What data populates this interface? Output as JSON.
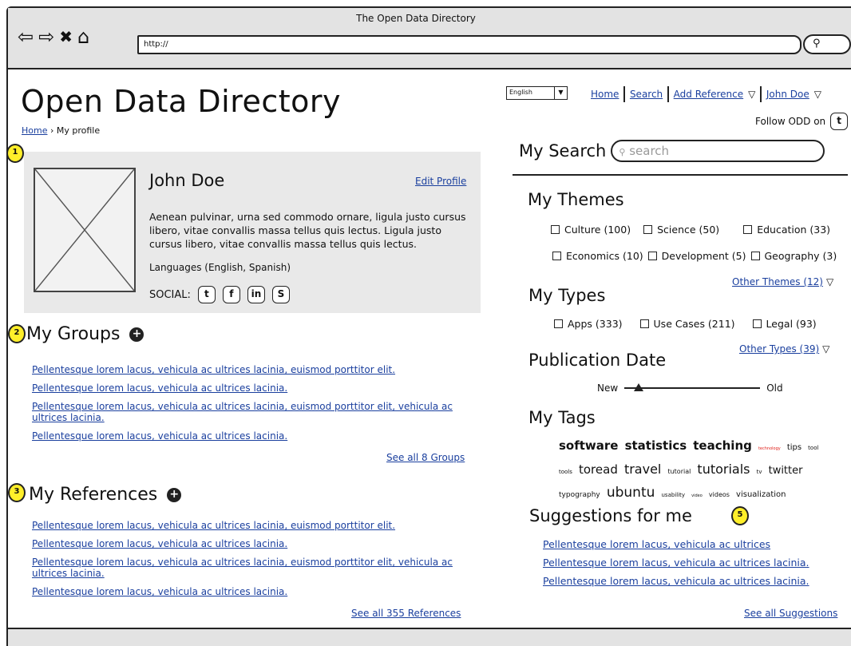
{
  "window": {
    "title": "The Open Data Directory",
    "url": "http://"
  },
  "page": {
    "title": "Open Data Directory",
    "breadcrumb": {
      "home": "Home",
      "separator": "›",
      "current": "My profile"
    }
  },
  "badges": [
    "1",
    "2",
    "3",
    "5"
  ],
  "profile": {
    "name": "John Doe",
    "edit_label": "Edit Profile",
    "bio": "Aenean pulvinar, urna sed commodo ornare, ligula justo cursus libero, vitae convallis massa tellus quis lectus. Ligula justo cursus libero, vitae convallis massa tellus quis lectus.",
    "languages": "Languages (English, Spanish)",
    "social_label": "SOCIAL:",
    "social_icons": [
      "twitter-icon",
      "facebook-icon",
      "linkedin-icon",
      "skype-icon"
    ]
  },
  "groups": {
    "heading": "My Groups",
    "items": [
      "Pellentesque lorem lacus, vehicula ac ultrices lacinia, euismod porttitor elit.",
      "Pellentesque lorem lacus, vehicula ac ultrices lacinia.",
      "Pellentesque lorem lacus, vehicula ac ultrices lacinia, euismod porttitor elit, vehicula ac ultrices lacinia.",
      "Pellentesque lorem lacus, vehicula ac ultrices lacinia."
    ],
    "see_all": "See all 8 Groups"
  },
  "references": {
    "heading": "My References",
    "items": [
      "Pellentesque lorem lacus, vehicula ac ultrices lacinia, euismod porttitor elit.",
      "Pellentesque lorem lacus, vehicula ac ultrices lacinia.",
      "Pellentesque lorem lacus, vehicula ac ultrices lacinia, euismod porttitor elit, vehicula ac ultrices lacinia.",
      "Pellentesque lorem lacus, vehicula ac ultrices lacinia."
    ],
    "see_all": "See all 355 References"
  },
  "header": {
    "language": "English",
    "nav": {
      "home": "Home",
      "search": "Search",
      "add_reference": "Add Reference",
      "user": "John Doe"
    },
    "follow": "Follow ODD on"
  },
  "search": {
    "heading": "My Search",
    "placeholder": "search"
  },
  "themes": {
    "heading": "My Themes",
    "row1": [
      "Culture (100)",
      "Science (50)",
      "Education (33)"
    ],
    "row2": [
      "Economics (10)",
      "Development (5)",
      "Geography (3)"
    ],
    "other": "Other Themes (12)"
  },
  "types": {
    "heading": "My Types",
    "items": [
      "Apps (333)",
      "Use Cases (211)",
      "Legal (93)"
    ],
    "other": "Other Types (39)"
  },
  "publication": {
    "heading": "Publication Date",
    "new_label": "New",
    "old_label": "Old"
  },
  "tags": {
    "heading": "My Tags",
    "items": [
      {
        "text": "software",
        "size": 15,
        "color": "#111",
        "bold": true
      },
      {
        "text": "statistics",
        "size": 15,
        "color": "#111",
        "bold": true
      },
      {
        "text": "teaching",
        "size": 15,
        "color": "#111",
        "bold": true
      },
      {
        "text": "technology",
        "size": 5,
        "color": "#e0201a",
        "bold": false
      },
      {
        "text": "tips",
        "size": 10,
        "color": "#111",
        "bold": false
      },
      {
        "text": "tool",
        "size": 7,
        "color": "#111",
        "bold": false
      },
      {
        "text": "tools",
        "size": 7,
        "color": "#111",
        "bold": false
      },
      {
        "text": "toread",
        "size": 15,
        "color": "#111",
        "bold": false
      },
      {
        "text": "travel",
        "size": 16,
        "color": "#111",
        "bold": false
      },
      {
        "text": "tutorial",
        "size": 8,
        "color": "#111",
        "bold": false
      },
      {
        "text": "tutorials",
        "size": 16,
        "color": "#111",
        "bold": false
      },
      {
        "text": "tv",
        "size": 7,
        "color": "#111",
        "bold": false
      },
      {
        "text": "twitter",
        "size": 13,
        "color": "#111",
        "bold": false
      },
      {
        "text": "typography",
        "size": 9,
        "color": "#111",
        "bold": false
      },
      {
        "text": "ubuntu",
        "size": 17,
        "color": "#111",
        "bold": false
      },
      {
        "text": "usability",
        "size": 7,
        "color": "#111",
        "bold": false
      },
      {
        "text": "video",
        "size": 5,
        "color": "#111",
        "bold": false
      },
      {
        "text": "videos",
        "size": 8,
        "color": "#111",
        "bold": false
      },
      {
        "text": "visualization",
        "size": 10,
        "color": "#111",
        "bold": false
      }
    ]
  },
  "suggestions": {
    "heading": "Suggestions for me",
    "items": [
      "Pellentesque lorem lacus, vehicula ac ultrices",
      "Pellentesque lorem lacus, vehicula ac ultrices lacinia.",
      "Pellentesque lorem lacus, vehicula ac ultrices lacinia."
    ],
    "see_all": "See all Suggestions"
  }
}
